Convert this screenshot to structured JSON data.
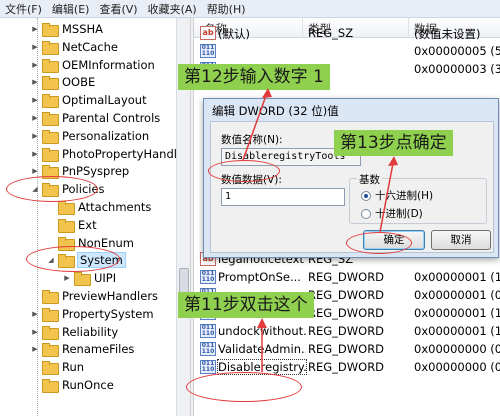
{
  "menu": [
    "文件(F)",
    "编辑(E)",
    "查看(V)",
    "收藏夹(A)",
    "帮助(H)"
  ],
  "tree": {
    "items": [
      {
        "label": "MSSHA",
        "indent": 1,
        "expander": "▶"
      },
      {
        "label": "NetCache",
        "indent": 1,
        "expander": "▶"
      },
      {
        "label": "OEMInformation",
        "indent": 1,
        "expander": "▶"
      },
      {
        "label": "OOBE",
        "indent": 1,
        "expander": "▶"
      },
      {
        "label": "OptimalLayout",
        "indent": 1,
        "expander": "▶"
      },
      {
        "label": "Parental Controls",
        "indent": 1,
        "expander": "▶"
      },
      {
        "label": "Personalization",
        "indent": 1,
        "expander": "▶"
      },
      {
        "label": "PhotoPropertyHandler",
        "indent": 1,
        "expander": "▶"
      },
      {
        "label": "PnPSysprep",
        "indent": 1,
        "expander": "▶"
      },
      {
        "label": "Policies",
        "indent": 1,
        "expander": "◢"
      },
      {
        "label": "Attachments",
        "indent": 2,
        "expander": ""
      },
      {
        "label": "Ext",
        "indent": 2,
        "expander": ""
      },
      {
        "label": "NonEnum",
        "indent": 2,
        "expander": ""
      },
      {
        "label": "System",
        "indent": 2,
        "expander": "◢"
      },
      {
        "label": "UIPI",
        "indent": 3,
        "expander": "▶"
      },
      {
        "label": "PreviewHandlers",
        "indent": 1,
        "expander": ""
      },
      {
        "label": "PropertySystem",
        "indent": 1,
        "expander": "▶"
      },
      {
        "label": "Reliability",
        "indent": 1,
        "expander": "▶"
      },
      {
        "label": "RenameFiles",
        "indent": 1,
        "expander": "▶"
      },
      {
        "label": "Run",
        "indent": 1,
        "expander": ""
      },
      {
        "label": "RunOnce",
        "indent": 1,
        "expander": ""
      }
    ]
  },
  "list": {
    "headers": {
      "name": "名称",
      "type": "类型",
      "data": "数据"
    },
    "rows": [
      {
        "icon": "string-value-icon",
        "name": "(默认)",
        "type": "REG_SZ",
        "data": "(数值未设置)"
      },
      {
        "icon": "dword-value-icon",
        "name": "",
        "type": "",
        "data": "0x00000005 (5)"
      },
      {
        "icon": "dword-value-icon",
        "name": "",
        "type": "",
        "data": "0x00000003 (3)"
      },
      {
        "icon": "string-value-icon",
        "name": "legalnoticetext",
        "type": "REG_SZ",
        "data": ""
      },
      {
        "icon": "dword-value-icon",
        "name": "PromptOnSe...",
        "type": "REG_DWORD",
        "data": "0x00000001 (1)"
      },
      {
        "icon": "dword-value-icon",
        "name": "",
        "type": "REG_DWORD",
        "data": "0x00000001 (0)"
      },
      {
        "icon": "dword-value-icon",
        "name": "shutdownwithot...",
        "type": "REG_DWORD",
        "data": "0x00000001 (1)"
      },
      {
        "icon": "dword-value-icon",
        "name": "undockwithout...",
        "type": "REG_DWORD",
        "data": "0x00000001 (1)"
      },
      {
        "icon": "dword-value-icon",
        "name": "ValidateAdmin...",
        "type": "REG_DWORD",
        "data": "0x00000000 (0)"
      },
      {
        "icon": "dword-value-icon",
        "name": "Disableregistry...",
        "type": "REG_DWORD",
        "data": "0x00000000 (0)"
      }
    ]
  },
  "dialog": {
    "title": "编辑 DWORD (32 位)值",
    "value_name_label": "数值名称(N):",
    "value_name": "DisableregistryTools",
    "value_data_label": "数值数据(V):",
    "value_data": "1",
    "base_label": "基数",
    "base_hex": "十六进制(H)",
    "base_dec": "十进制(D)",
    "base_selected": "hex",
    "ok_label": "确定",
    "cancel_label": "取消"
  },
  "annotations": {
    "step11": "第11步双击这个",
    "step12": "第12步输入数字 1",
    "step13": "第13步点确定",
    "accent": "#e23b3b",
    "label_bg": "#8fd14f"
  }
}
